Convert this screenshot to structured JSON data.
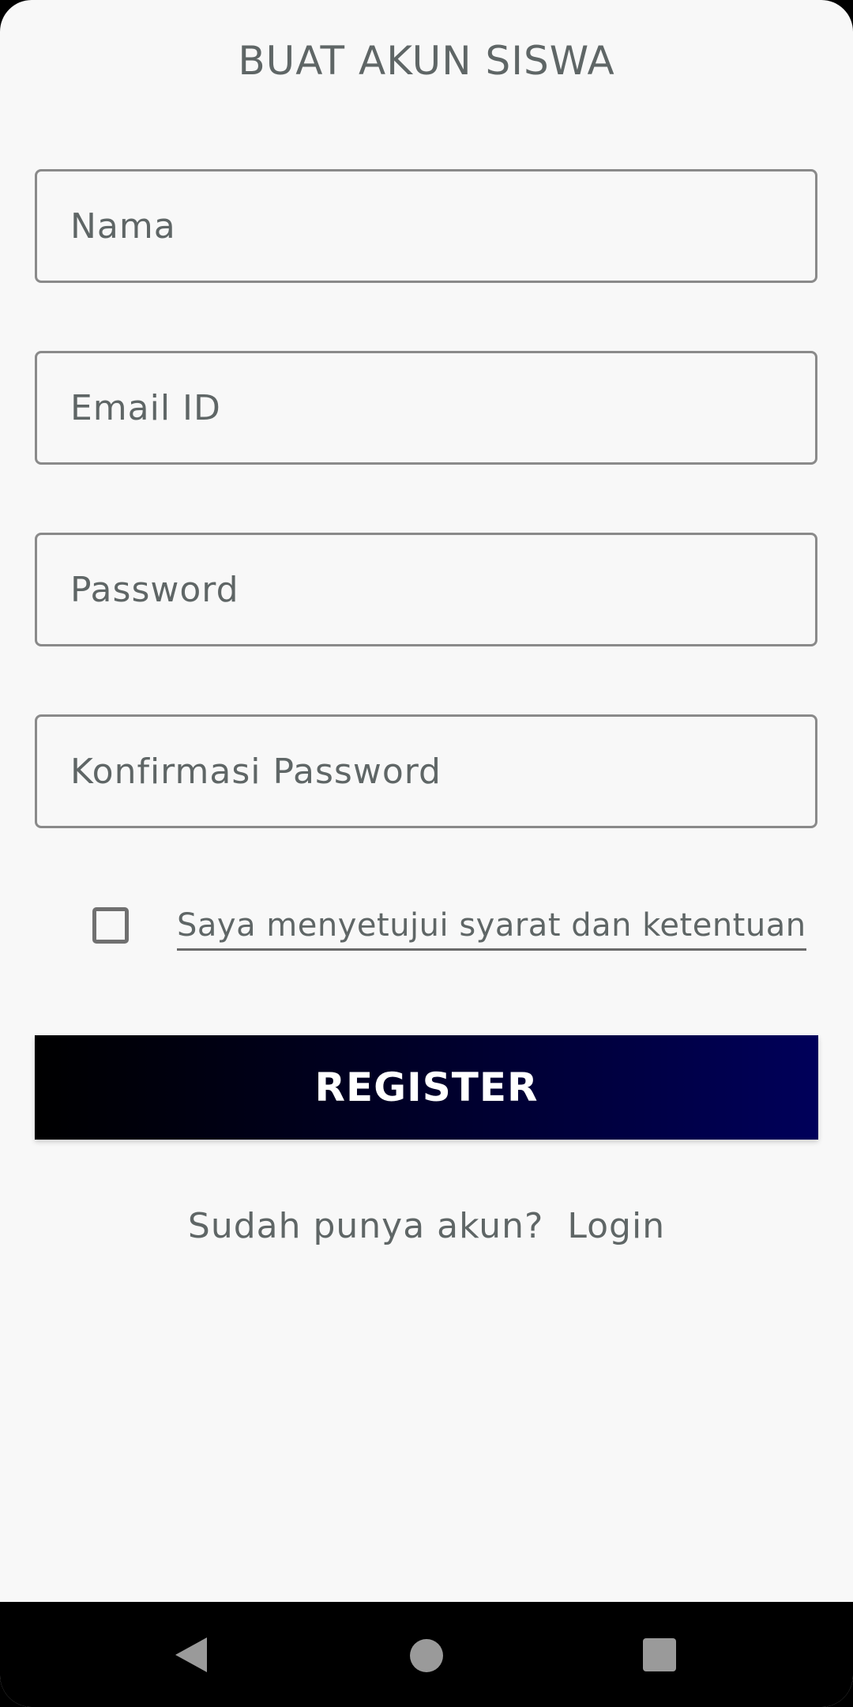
{
  "header": {
    "title": "BUAT AKUN SISWA"
  },
  "form": {
    "name_placeholder": "Nama",
    "email_placeholder": "Email ID",
    "password_placeholder": "Password",
    "confirm_password_placeholder": "Konfirmasi Password",
    "terms_checked": false,
    "terms_label": "Saya menyetujui syarat dan ketentuan",
    "register_label": "REGISTER"
  },
  "footer": {
    "have_account_text": "Sudah punya akun?",
    "login_label": "Login"
  },
  "navigation_bar": {
    "back_icon": "back-triangle-icon",
    "home_icon": "home-circle-icon",
    "recents_icon": "recents-square-icon"
  },
  "colors": {
    "background": "#f8f8f8",
    "text": "#5f6666",
    "button_gradient_start": "#000000",
    "button_gradient_end": "#00005a",
    "navbar": "#000000"
  }
}
